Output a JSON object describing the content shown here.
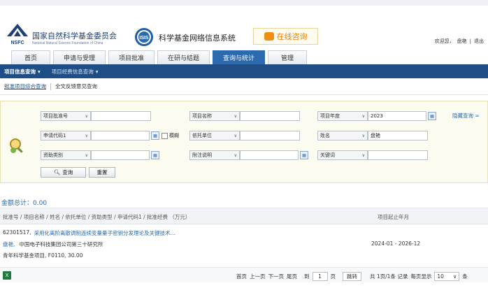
{
  "header": {
    "org_title": "国家自然科学基金委员会",
    "org_subtitle": "National Natural Science Foundation of China",
    "nsfc_logo_text": "NSFC",
    "isis_logo_text": "ISIS",
    "system_title": "科学基金网络信息系统",
    "consult_label": "在线咨询",
    "welcome": "欢迎您，",
    "user_name": "盘艳",
    "logout_sep": "|",
    "logout_label": "退出"
  },
  "nav": {
    "tabs": [
      "首页",
      "申请与受理",
      "项目批准",
      "在研与结题",
      "查询与统计",
      "管理"
    ],
    "active": "查询与统计"
  },
  "subnav": {
    "items": [
      "项目信息查询",
      "项目经费信息查询"
    ]
  },
  "tabs2": {
    "items": [
      "批准项目综合查询",
      "全文反馈意见查询"
    ]
  },
  "search": {
    "f1_select": "项目批准号",
    "f1_value": "",
    "f2_select": "项目名称",
    "f2_value": "",
    "f3_select": "项目年度",
    "f3_value": "2023",
    "f4_select": "申请代码1",
    "f4_value": "",
    "fuzzy_label": "模糊",
    "f5_select": "依托单位",
    "f5_value": "",
    "f6_select": "姓名",
    "f6_value": "盘艳",
    "f7_select": "资助类别",
    "f7_value": "",
    "f8_select": "附注说明",
    "f8_value": "",
    "f9_select": "关键词",
    "f9_value": "",
    "query_btn": "查询",
    "reset_btn": "重置",
    "hide_link": "隐藏查询 ≈"
  },
  "summary": {
    "total_label": "金额总计：0.00"
  },
  "table": {
    "header_left": "批准号 / 项目名称 / 姓名 / 依托单位 / 资助类型 / 申请代码1 / 批准经费 （万元）",
    "header_right": "项目起止年月",
    "rows": [
      {
        "id": "62301517,",
        "title": "采用化离阶离散调制连续变量量子密钥分发理论及关键技术…",
        "person": "盘艳,",
        "org": "中国电子科技集团公司第三十研究所",
        "line3": "青年科学基金项目, F0110, 30.00",
        "period": "2024-01 - 2026-12"
      }
    ]
  },
  "footer": {
    "excel_icon": "X",
    "first": "首页",
    "prev": "上一页",
    "next": "下一页",
    "last": "尾页",
    "goto_prefix": "到",
    "page_value": "1",
    "goto_suffix": "页",
    "jump": "跳转",
    "total_info": "共 1页/1条 记录",
    "per_page_label": "每页显示",
    "per_page_value": "10",
    "per_page_suffix": "条"
  },
  "colors": {
    "brand_blue": "#1f4e86",
    "tab_active": "#2a6aad",
    "consult_orange": "#e9820e",
    "search_bg": "#fbfbf0"
  }
}
